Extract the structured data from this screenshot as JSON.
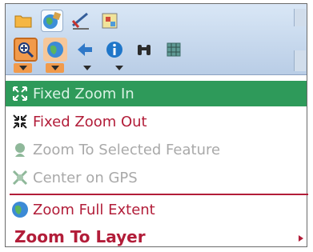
{
  "toolbar": {
    "tab_icons": [
      "folder-icon",
      "map-tools-icon",
      "edit-icon",
      "layers-icon"
    ],
    "tools": [
      "fixed-zoom-in-icon",
      "globe-icon",
      "back-arrow-icon",
      "info-icon",
      "binoculars-icon",
      "grid-icon"
    ]
  },
  "menu": {
    "items": [
      {
        "label": "Fixed Zoom In",
        "icon": "expand-arrows-icon",
        "style": "highlight"
      },
      {
        "label": "Fixed Zoom Out",
        "icon": "contract-arrows-icon",
        "style": "red"
      },
      {
        "label": "Zoom To Selected Feature",
        "icon": "selected-feature-icon",
        "style": "gray"
      },
      {
        "label": "Center on GPS",
        "icon": "gps-icon",
        "style": "gray"
      },
      {
        "label": "Zoom Full Extent",
        "icon": "globe-icon",
        "style": "red"
      },
      {
        "label": "Zoom To Layer",
        "icon": "",
        "style": "bold",
        "has_submenu": true
      }
    ]
  },
  "colors": {
    "highlight": "#2e9a5a",
    "menu_text": "#b21d39",
    "disabled_text": "#a9a9a9",
    "selected_tool": "#f19a4b"
  }
}
